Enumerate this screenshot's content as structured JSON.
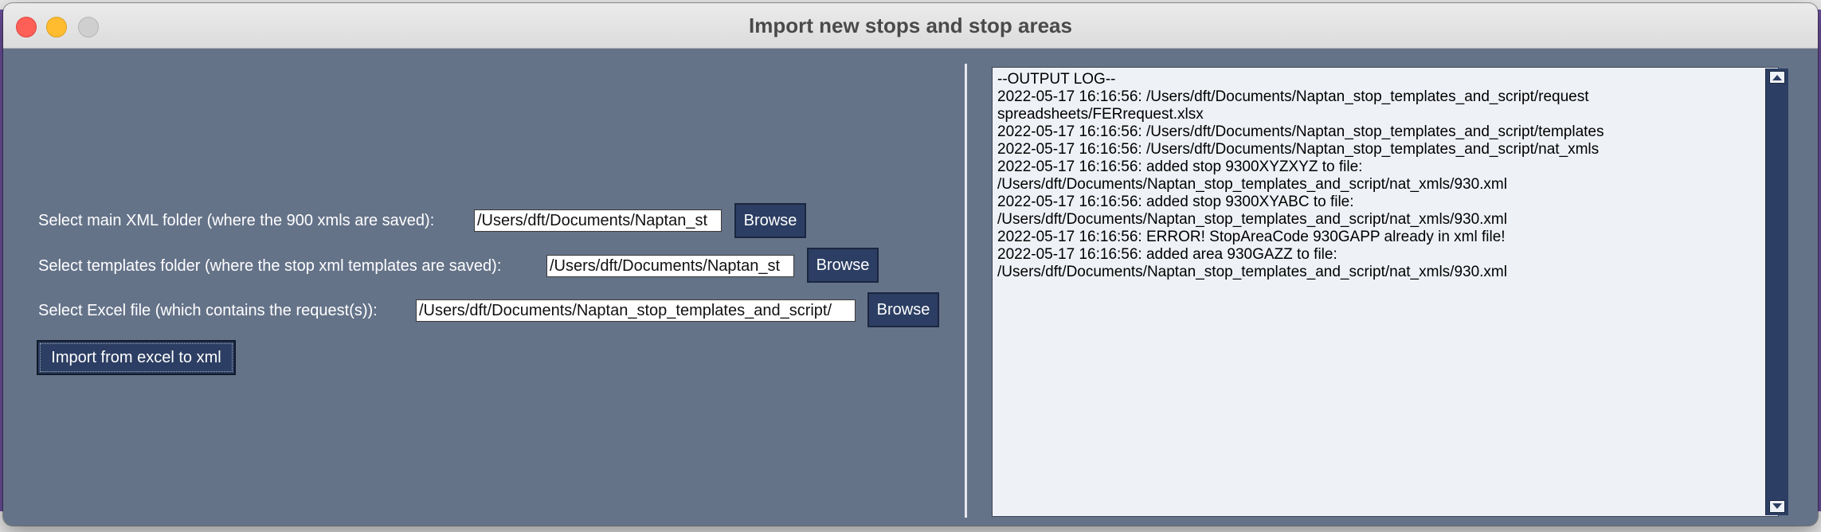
{
  "window": {
    "title": "Import new stops and stop areas"
  },
  "form": {
    "xml_folder": {
      "label": "Select main XML folder (where the 900 xmls are saved):",
      "value": "/Users/dft/Documents/Naptan_st",
      "button": "Browse"
    },
    "templates_folder": {
      "label": "Select templates folder (where the stop xml templates are saved):",
      "value": "/Users/dft/Documents/Naptan_st",
      "button": "Browse"
    },
    "excel_file": {
      "label": "Select Excel file (which contains the request(s)):",
      "value": "/Users/dft/Documents/Naptan_stop_templates_and_script/",
      "button": "Browse"
    },
    "import_button": "Import from excel to xml"
  },
  "log": {
    "lines": [
      "--OUTPUT LOG--",
      "2022-05-17 16:16:56: /Users/dft/Documents/Naptan_stop_templates_and_script/request",
      "spreadsheets/FERrequest.xlsx",
      "2022-05-17 16:16:56: /Users/dft/Documents/Naptan_stop_templates_and_script/templates",
      "2022-05-17 16:16:56: /Users/dft/Documents/Naptan_stop_templates_and_script/nat_xmls",
      "2022-05-17 16:16:56: added stop 9300XYZXYZ to file:",
      "/Users/dft/Documents/Naptan_stop_templates_and_script/nat_xmls/930.xml",
      "2022-05-17 16:16:56: added stop 9300XYABC to file:",
      "/Users/dft/Documents/Naptan_stop_templates_and_script/nat_xmls/930.xml",
      "2022-05-17 16:16:56: ERROR! StopAreaCode 930GAPP already in xml file!",
      "2022-05-17 16:16:56: added area 930GAZZ to file:",
      "/Users/dft/Documents/Naptan_stop_templates_and_script/nat_xmls/930.xml"
    ]
  },
  "colors": {
    "panel_bg": "#657389",
    "button_bg": "#2c3e63",
    "log_bg": "#eef1f6"
  }
}
